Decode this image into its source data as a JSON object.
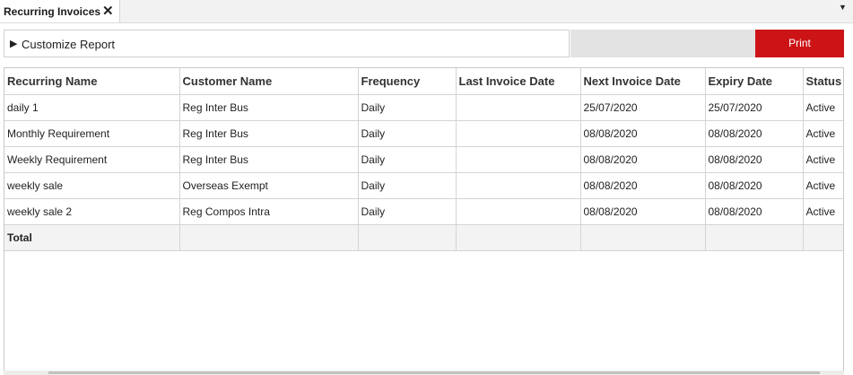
{
  "tab": {
    "title": "Recurring Invoices",
    "close_glyph": "✕",
    "dropdown_glyph": "▼"
  },
  "customize": {
    "arrow": "▶",
    "label": "Customize Report"
  },
  "print_label": "Print",
  "table": {
    "columns": [
      "Recurring Name",
      "Customer Name",
      "Frequency",
      "Last Invoice Date",
      "Next Invoice Date",
      "Expiry Date",
      "Status"
    ],
    "rows": [
      [
        "daily 1",
        "Reg Inter Bus",
        "Daily",
        "",
        "25/07/2020",
        "25/07/2020",
        "Active"
      ],
      [
        "Monthly Requirement",
        "Reg Inter Bus",
        "Daily",
        "",
        "08/08/2020",
        "08/08/2020",
        "Active"
      ],
      [
        "Weekly Requirement",
        "Reg Inter Bus",
        "Daily",
        "",
        "08/08/2020",
        "08/08/2020",
        "Active"
      ],
      [
        "weekly sale",
        "Overseas Exempt",
        "Daily",
        "",
        "08/08/2020",
        "08/08/2020",
        "Active"
      ],
      [
        "weekly sale 2",
        "Reg Compos Intra",
        "Daily",
        "",
        "08/08/2020",
        "08/08/2020",
        "Active"
      ]
    ],
    "total_label": "Total"
  },
  "colors": {
    "print_button": "#cc1417",
    "header_text": "#333333",
    "grid_border": "#d4d4d4"
  }
}
